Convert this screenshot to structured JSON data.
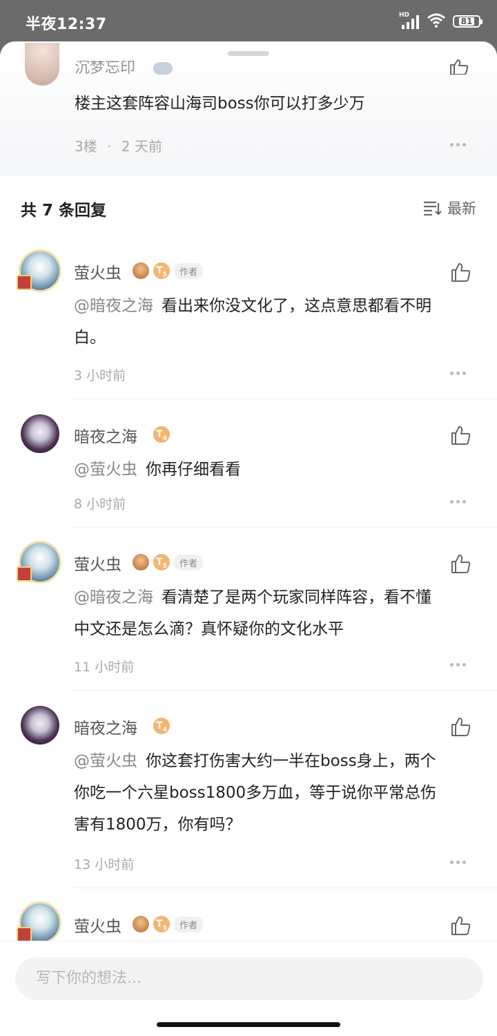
{
  "status_bar": {
    "time": "半夜12:37",
    "network": "HD",
    "battery": "81"
  },
  "top_post": {
    "author_name": "沉梦忘印",
    "text": "楼主这套阵容山海司boss你可以打多少万",
    "floor": "3楼",
    "separator": "·",
    "time_ago": "2 天前"
  },
  "replies": {
    "header": "共 7 条回复",
    "sort_label": "最新"
  },
  "comments": [
    {
      "name": "萤火虫",
      "level": "5",
      "is_author": true,
      "author_tag": "作者",
      "mention": "@暗夜之海",
      "lines": [
        "看出来你没文化了，这点意思都看不明",
        "白。"
      ],
      "time": "3 小时前"
    },
    {
      "name": "暗夜之海",
      "level": "4",
      "is_author": false,
      "mention": "@萤火虫",
      "lines": [
        "你再仔细看看"
      ],
      "time": "8 小时前"
    },
    {
      "name": "萤火虫",
      "level": "5",
      "is_author": true,
      "author_tag": "作者",
      "mention": "@暗夜之海",
      "lines": [
        "看清楚了是两个玩家同样阵容，看不懂",
        "中文还是怎么滴？真怀疑你的文化水平"
      ],
      "time": "11 小时前"
    },
    {
      "name": "暗夜之海",
      "level": "4",
      "is_author": false,
      "mention": "@萤火虫",
      "lines": [
        "你这套打伤害大约一半在boss身上，两个",
        "你吃一个六星boss1800多万血，等于说你平常总伤",
        "害有1800万，你有吗？"
      ],
      "time": "13 小时前"
    },
    {
      "name": "萤火虫",
      "level": "5",
      "is_author": true,
      "author_tag": "作者"
    }
  ],
  "input": {
    "placeholder": "写下你的想法..."
  },
  "icons": {
    "like": "thumbs-up-icon",
    "more": "more-dots-icon",
    "sort": "sort-list-icon",
    "wifi": "wifi-icon",
    "signal": "signal-icon",
    "battery": "battery-icon"
  }
}
